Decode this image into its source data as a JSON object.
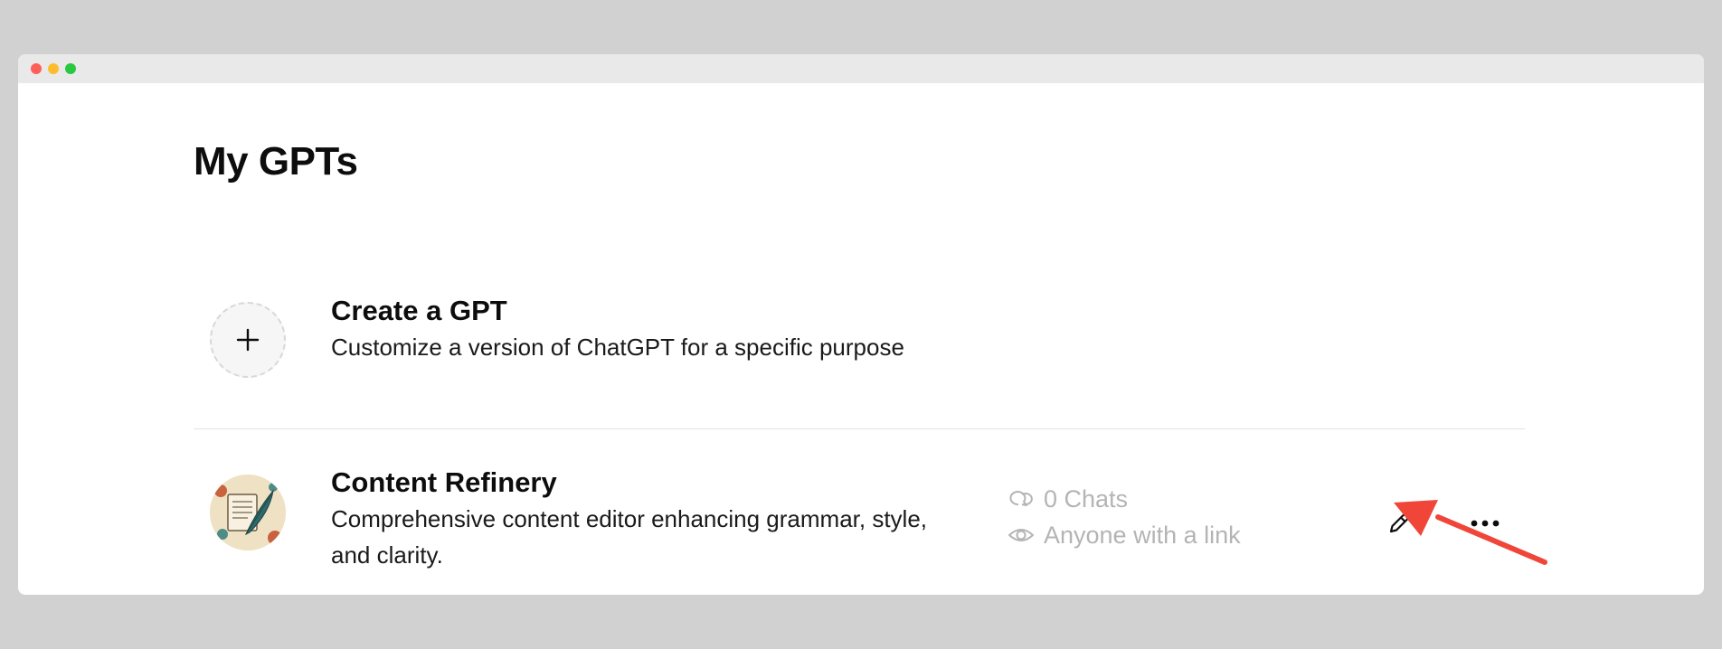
{
  "page": {
    "title": "My GPTs"
  },
  "create": {
    "title": "Create a GPT",
    "description": "Customize a version of ChatGPT for a specific purpose",
    "icon": "plus-icon"
  },
  "gpts": [
    {
      "name": "Content Refinery",
      "description": "Comprehensive content editor enhancing grammar, style, and clarity.",
      "chats": "0 Chats",
      "visibility": "Anyone with a link",
      "chats_icon": "chat-bubbles-icon",
      "visibility_icon": "eye-icon",
      "edit_icon": "pencil-icon",
      "more_icon": "ellipsis-icon"
    }
  ],
  "annotation": {
    "color": "#f0463a",
    "type": "arrow-pointing-to-edit-button"
  },
  "window": {
    "controls": [
      "close",
      "minimize",
      "maximize"
    ]
  }
}
